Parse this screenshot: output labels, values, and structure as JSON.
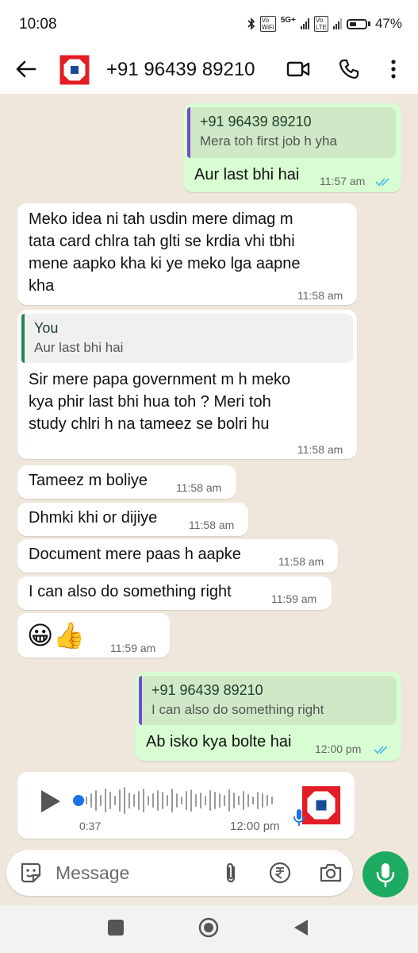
{
  "status_bar": {
    "time": "10:08",
    "network": "5G+",
    "battery": "47%",
    "battery_level": 0.47
  },
  "header": {
    "contact_name": "+91 96439 89210",
    "back_icon": "arrow-left-icon",
    "video_icon": "video-call-icon",
    "call_icon": "phone-icon",
    "menu_icon": "more-vert-icon"
  },
  "messages": [
    {
      "dir": "out",
      "quote_name": "+91 96439 89210",
      "quote_text": "Mera toh first job h yha",
      "text": "Aur last bhi hai",
      "time": "11:57 am"
    },
    {
      "dir": "in",
      "lines": [
        "Meko idea ni tah usdin mere dimag m",
        "tata card chlra tah glti se krdia vhi tbhi",
        "mene aapko kha ki ye meko lga aapne",
        "kha"
      ],
      "time": "11:58 am"
    },
    {
      "dir": "in",
      "quote_name": "You",
      "quote_text": "Aur last bhi hai",
      "lines": [
        "Sir mere papa government m h meko",
        "kya phir last bhi hua toh ? Meri toh",
        "study chlri h na tameez se bolri hu"
      ],
      "time": "11:58 am"
    },
    {
      "dir": "in",
      "text": "Tameez m boliye",
      "time": "11:58 am"
    },
    {
      "dir": "in",
      "text": "Dhmki khi or dijiye",
      "time": "11:58 am"
    },
    {
      "dir": "in",
      "text": "Document mere paas h aapke",
      "time": "11:58 am"
    },
    {
      "dir": "in",
      "text": "I can also do something right",
      "time": "11:59 am"
    },
    {
      "dir": "in",
      "text": "😀👍",
      "time": "11:59 am"
    },
    {
      "dir": "out",
      "quote_name": "+91 96439 89210",
      "quote_text": "I can also do something right",
      "text": "Ab isko kya bolte hai",
      "time": "12:00 pm"
    },
    {
      "dir": "in",
      "type": "voice",
      "duration": "0:37",
      "time": "12:00 pm"
    }
  ],
  "composer": {
    "placeholder": "Message",
    "emoji_icon": "sticker-icon",
    "attach_icon": "paperclip-icon",
    "payment_icon": "rupee-icon",
    "camera_icon": "camera-icon",
    "mic_icon": "mic-icon"
  },
  "nav": {
    "recents_icon": "square-icon",
    "home_icon": "circle-icon",
    "back_icon": "triangle-back-icon"
  },
  "colors": {
    "outgoing_bubble": "#d9fdd3",
    "incoming_bubble": "#ffffff",
    "chat_bg": "#efe7dc",
    "read_ticks": "#53bdeb",
    "fab": "#1dab61",
    "quote_bar_out": "#6f4ccf",
    "quote_bar_in": "#1b8755",
    "avatar_red": "#e31d25",
    "avatar_blue": "#1a4b9b"
  }
}
